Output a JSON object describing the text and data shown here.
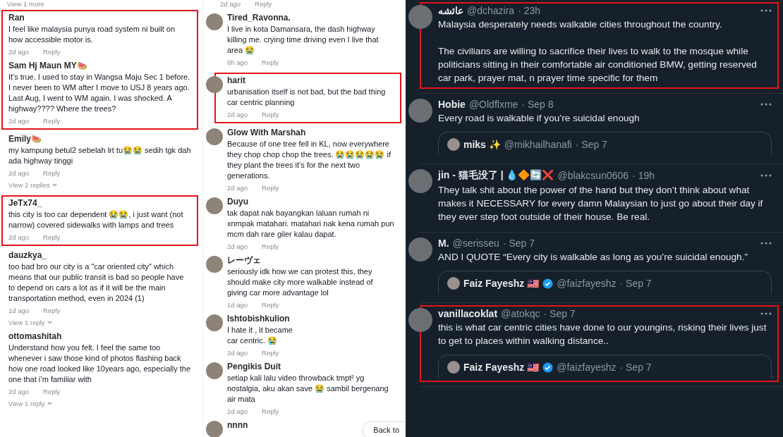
{
  "comments_panel": {
    "columns": [
      {
        "top_link": "View 1 more",
        "groups": [
          {
            "highlighted": true,
            "comments": [
              {
                "user": "Ran",
                "text": "I feel like malaysia punya road system ni built on how accessible motor is.",
                "time": "2d ago",
                "reply": "Reply"
              },
              {
                "user": "Sam Hj Maun MY🍉",
                "text": "It's true. I used to stay in Wangsa Maju Sec 1 before. I never been to WM after I move to USJ 8 years ago. Last Aug, I went to WM again. I was shocked. A highway???? Where the trees?",
                "time": "2d ago",
                "reply": "Reply"
              }
            ]
          },
          {
            "highlighted": false,
            "comments": [
              {
                "user": "Emily🍉",
                "text": "my kampung betul2 sebelah lrt tu😭😭 sedih tgk dah ada highway tinggi",
                "time": "2d ago",
                "reply": "Reply",
                "replies_link": "View 2 replies"
              }
            ]
          },
          {
            "highlighted": true,
            "comments": [
              {
                "user": "JeTx74_",
                "text": "this city is too car dependent 😭😭, i just want (not narrow) covered sidewalks with lamps and trees",
                "time": "2d ago",
                "reply": "Reply"
              }
            ]
          },
          {
            "highlighted": false,
            "comments": [
              {
                "user": "dauzkya_",
                "text": "too bad bro our city is a \"car oriented city\" which means that our public transit is bad so people have to depend on cars a lot as if it will be the main transportation method, even in 2024 (1)",
                "time": "1d ago",
                "reply": "Reply",
                "replies_link": "View 1 reply"
              },
              {
                "user": "ottomashitah",
                "text": "Understand how you felt. I feel the same too whenever i saw those kind of photos flashing back how one road looked like 10years ago, especially the one that i’m familiar with",
                "time": "2d ago",
                "reply": "Reply",
                "replies_link": "View 1 reply"
              }
            ]
          }
        ]
      },
      {
        "top_meta": {
          "time": "2d ago",
          "reply": "Reply"
        },
        "groups": [
          {
            "highlighted": false,
            "comments": [
              {
                "user": "Tired_Ravonna.",
                "text": "I live in kota Damansara, the dash highway killing me. crying time driving even I live that area 😭",
                "time": "6h ago",
                "reply": "Reply"
              }
            ]
          },
          {
            "highlighted": true,
            "comments": [
              {
                "user": "harit",
                "text": "urbanisation itself is not bad, but the bad thing car centric planning",
                "time": "2d ago",
                "reply": "Reply"
              }
            ]
          },
          {
            "highlighted": false,
            "comments": [
              {
                "user": "Glow With Marshah",
                "text": "Because of one tree fell in KL, now everywhere they chop chop chop the trees. 😭😭😭😭😭 if they plant the trees it’s for the next two generations.",
                "time": "2d ago",
                "reply": "Reply"
              },
              {
                "user": "Duyu",
                "text": "tak dapat nak bayangkan laluan rumah ni xnmpak matahari. matahari nak kena rumah pun mcm dah rare giler kalau dapat.",
                "time": "2d ago",
                "reply": "Reply"
              },
              {
                "user": "レーヴェ",
                "text": "seriously idk how we can protest this, they should make city more walkable instead of giving car more advantage lol",
                "time": "1d ago",
                "reply": "Reply"
              },
              {
                "user": "Ishtobishkulion",
                "text": "I hate it , it became\ncar centric. 😭",
                "time": "2d ago",
                "reply": "Reply"
              },
              {
                "user": "Pengikis Duit",
                "text": "setiap kali lalu video throwback tmpt² yg nostalgia, aku akan save 😭 sambil bergenang air mata",
                "time": "2d ago",
                "reply": "Reply"
              },
              {
                "user": "nnnn"
              }
            ]
          }
        ],
        "floating_button": "Back to"
      }
    ]
  },
  "tweets": [
    {
      "name": "عائشه",
      "handle": "@dchazira",
      "time": "· 23h",
      "text": "Malaysia desperately needs walkable cities throughout the country.\n\nThe civilians are willing to sacrifice their lives to walk to the mosque while politicians sitting in their comfortable air conditioned BMW, getting reserved car park, prayer mat, n prayer time specific for them",
      "highlighted": true,
      "verified": false
    },
    {
      "name": "Hobie",
      "handle": "@Oldflxme",
      "time": "· Sep 8",
      "text": "Every road is walkable if you’re suicidal enough",
      "highlighted": false,
      "verified": false,
      "quote": {
        "name": "miks ✨",
        "handle": "@mikhailhanafi",
        "time": "· Sep 7",
        "verified": false
      }
    },
    {
      "name": "jin - 猫毛没了 | 💧🔶🔄❌",
      "handle": "@blakcsun0606",
      "time": "· 19h",
      "text": "They talk shit about the power of the hand but they don’t think about what makes it NECESSARY for every damn Malaysian to just go about their day if they ever step foot outside of their house. Be real.",
      "highlighted": false,
      "verified": false
    },
    {
      "name": "M.",
      "handle": "@serisseu",
      "time": "· Sep 7",
      "text": "AND I QUOTE “Every city is walkable as long as you’re suicidal enough.”",
      "highlighted": false,
      "verified": false,
      "quote": {
        "name": "Faiz Fayeshz 🇲🇾",
        "handle": "@faizfayeshz",
        "time": "· Sep 7",
        "verified": true
      }
    },
    {
      "name": "vanillacoklat",
      "handle": "@atokqc",
      "time": "· Sep 7",
      "text": "this is what car centric cities have done to our youngins, risking their lives just to get to places within walking distance..",
      "highlighted": true,
      "verified": false,
      "quote": {
        "name": "Faiz Fayeshz 🇲🇾",
        "handle": "@faizfayeshz",
        "time": "· Sep 7",
        "verified": true
      }
    }
  ]
}
